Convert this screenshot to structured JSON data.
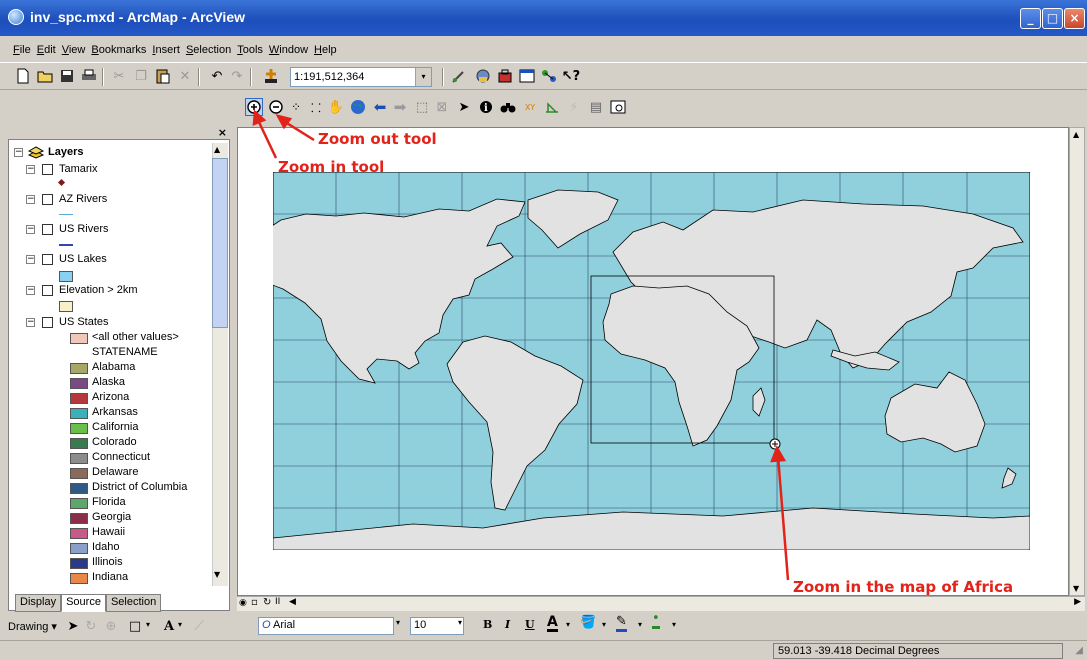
{
  "window": {
    "title": "inv_spc.mxd - ArcMap - ArcView",
    "minimize": "_",
    "maximize": "□",
    "close": "×"
  },
  "menu": [
    "File",
    "Edit",
    "View",
    "Bookmarks",
    "Insert",
    "Selection",
    "Tools",
    "Window",
    "Help"
  ],
  "toolbar": {
    "scale": "1:191,512,364",
    "scale_arrow": "▾"
  },
  "toc": {
    "root_label": "Layers",
    "layers": [
      {
        "label": "Tamarix"
      },
      {
        "label": "AZ Rivers"
      },
      {
        "label": "US Rivers"
      },
      {
        "label": "US Lakes"
      },
      {
        "label": "Elevation > 2km"
      },
      {
        "label": "US States"
      }
    ],
    "states_other": "<all other values>",
    "states_field": "STATENAME",
    "states": [
      {
        "name": "Alabama",
        "color": "#a8a866"
      },
      {
        "name": "Alaska",
        "color": "#7a4a86"
      },
      {
        "name": "Arizona",
        "color": "#b43a3a"
      },
      {
        "name": "Arkansas",
        "color": "#3cb0b8"
      },
      {
        "name": "California",
        "color": "#6abf4b"
      },
      {
        "name": "Colorado",
        "color": "#3a7a52"
      },
      {
        "name": "Connecticut",
        "color": "#8c8c8c"
      },
      {
        "name": "Delaware",
        "color": "#8a6a5a"
      },
      {
        "name": "District of Columbia",
        "color": "#2e5a86"
      },
      {
        "name": "Florida",
        "color": "#5ca86a"
      },
      {
        "name": "Georgia",
        "color": "#8a2e4a"
      },
      {
        "name": "Hawaii",
        "color": "#c85a8a"
      },
      {
        "name": "Idaho",
        "color": "#8aa0c8"
      },
      {
        "name": "Illinois",
        "color": "#2a3a86"
      },
      {
        "name": "Indiana",
        "color": "#e8874a"
      }
    ],
    "tabs": [
      "Display",
      "Source",
      "Selection"
    ]
  },
  "annotations": {
    "zoom_out": "Zoom out tool",
    "zoom_in": "Zoom in tool",
    "zoom_africa": "Zoom in the map of Africa"
  },
  "drawing": {
    "label": "Drawing",
    "font": "Arial",
    "size": "10",
    "bold": "B",
    "italic": "I",
    "underline": "U"
  },
  "status": {
    "coords": "59.013  -39.418 Decimal Degrees"
  },
  "colors": {
    "ocean": "#8fd0dc",
    "land": "#e2e2e2",
    "annotation": "#e2231a"
  }
}
